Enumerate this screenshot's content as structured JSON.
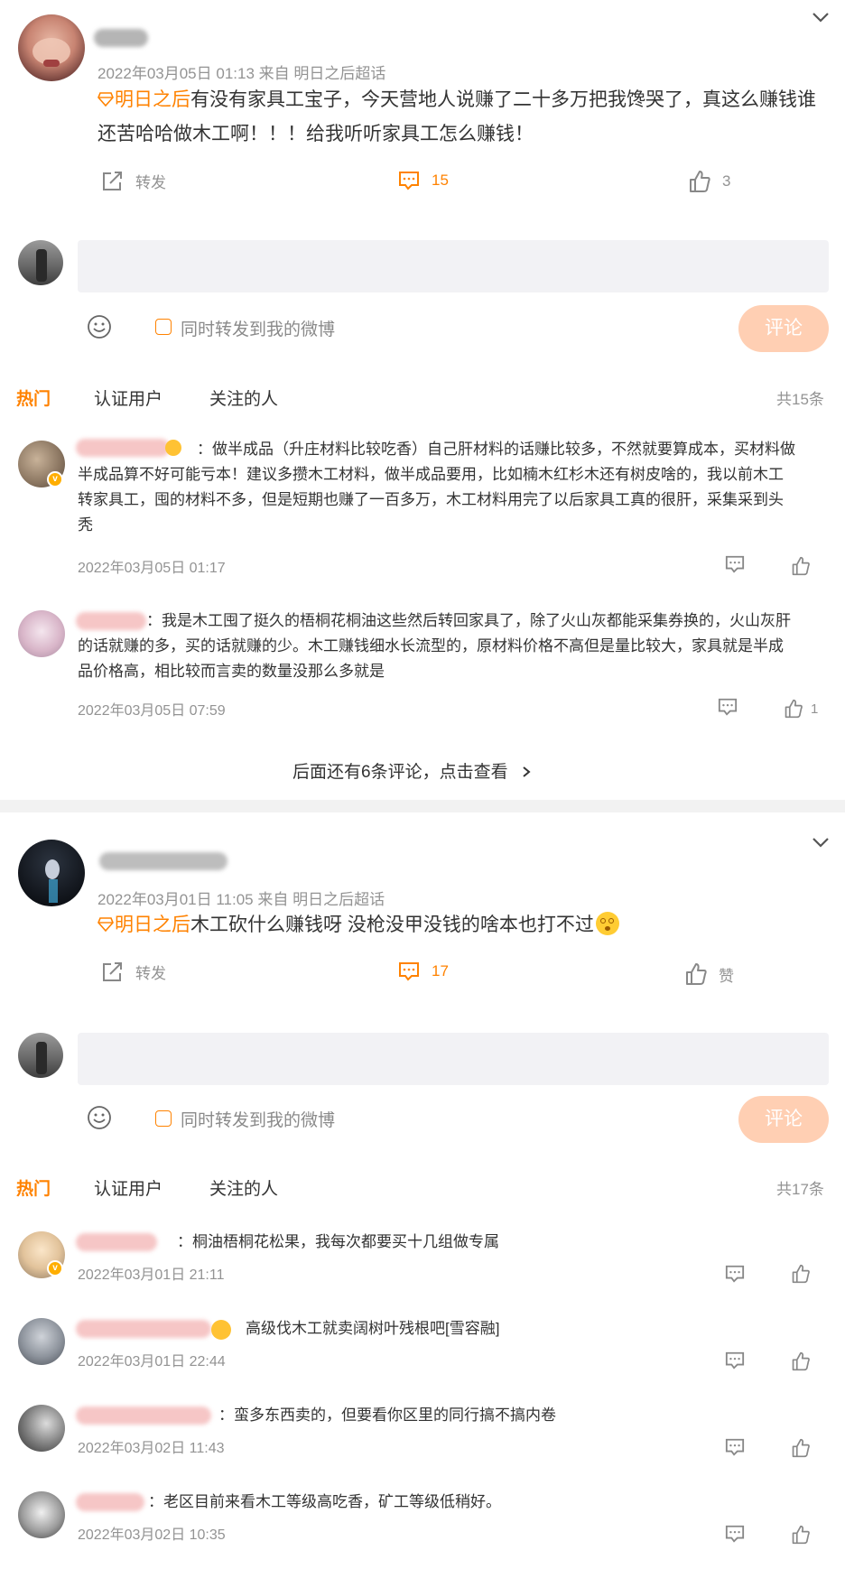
{
  "posts": [
    {
      "time_source": "2022年03月05日 01:13  来自 明日之后超话",
      "tag": "明日之后",
      "text_line1": "有没有家具工宝子，今天营地人说赚了二十多万把我馋哭了，真这么赚钱谁",
      "text_line2": "还苦哈哈做木工啊！！！给我听听家具工怎么赚钱！",
      "repost_label": "转发",
      "comment_count": "15",
      "like_count": "3",
      "sync_label": "同时转发到我的微博",
      "comment_button": "评论",
      "tabs": {
        "hot": "热门",
        "verified": "认证用户",
        "following": "关注的人"
      },
      "total": "共15条",
      "comments": [
        {
          "text_line1": "：做半成品（升庄材料比较吃香）自己肝材料的话赚比较多，不然就要算成本，买材料做",
          "text_line2": "半成品算不好可能亏本！建议多攒木工材料，做半成品要用，比如楠木红杉木还有树皮啥的，我以前木工",
          "text_line3": "转家具工，囤的材料不多，但是短期也赚了一百多万，木工材料用完了以后家具工真的很肝，采集采到头",
          "text_line4": "秃",
          "time": "2022年03月05日 01:17",
          "likes": ""
        },
        {
          "text_line1": "：我是木工囤了挺久的梧桐花桐油这些然后转回家具了，除了火山灰都能采集券换的，火山灰肝",
          "text_line2": "的话就赚的多，买的话就赚的少。木工赚钱细水长流型的，原材料价格不高但是量比较大，家具就是半成",
          "text_line3": "品价格高，相比较而言卖的数量没那么多就是",
          "time": "2022年03月05日 07:59",
          "likes": "1"
        }
      ],
      "more_label": "后面还有6条评论，点击查看"
    },
    {
      "time_source": "2022年03月01日 11:05  来自 明日之后超话",
      "tag": "明日之后",
      "text_line1": "木工砍什么赚钱呀 没枪没甲没钱的啥本也打不过",
      "repost_label": "转发",
      "comment_count": "17",
      "like_label": "赞",
      "sync_label": "同时转发到我的微博",
      "comment_button": "评论",
      "tabs": {
        "hot": "热门",
        "verified": "认证用户",
        "following": "关注的人"
      },
      "total": "共17条",
      "comments": [
        {
          "text": "：桐油梧桐花松果，我每次都要买十几组做专属",
          "time": "2022年03月01日 21:11"
        },
        {
          "text": "高级伐木工就卖阔树叶残根吧[雪容融]",
          "time": "2022年03月01日 22:44"
        },
        {
          "text": "：蛮多东西卖的，但要看你区里的同行搞不搞内卷",
          "time": "2022年03月02日 11:43"
        },
        {
          "text": "：老区目前来看木工等级高吃香，矿工等级低稍好。",
          "time": "2022年03月02日 10:35"
        }
      ]
    }
  ],
  "colors": {
    "accent": "#ff8200",
    "meta": "#939393",
    "button": "#ffcfb3"
  },
  "icons": [
    "chevron-down-icon",
    "repost-icon",
    "comment-icon",
    "like-icon",
    "emoji-icon",
    "chevron-right-icon",
    "gem-icon"
  ]
}
